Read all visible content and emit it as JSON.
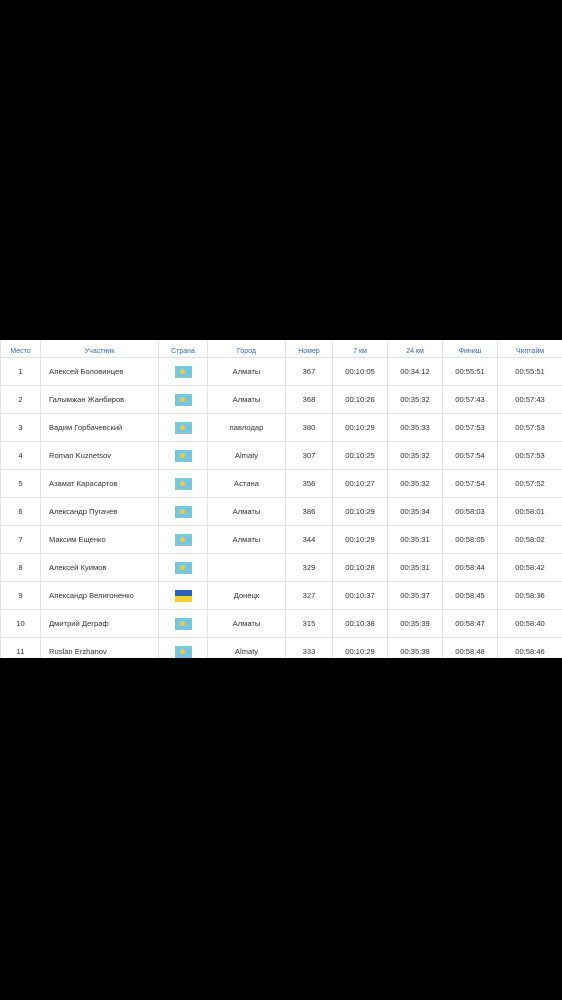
{
  "headers": [
    "Место",
    "Участник",
    "Страна",
    "Город",
    "Номер",
    "7 км",
    "24 км",
    "Финиш",
    "Чиптайм"
  ],
  "rows": [
    {
      "place": "1",
      "name": "Алексей Боловинцев",
      "flag": "kz-flag-icon",
      "city": "Алматы",
      "bib": "367",
      "split1": "00:10:05",
      "split2": "00:34:12",
      "finish": "00:55:51",
      "chip": "00:55:51"
    },
    {
      "place": "2",
      "name": "Галымжан Жанбиров",
      "flag": "kz-flag-icon",
      "city": "Алматы",
      "bib": "368",
      "split1": "00:10:26",
      "split2": "00:35:32",
      "finish": "00:57:43",
      "chip": "00:57:43"
    },
    {
      "place": "3",
      "name": "Вадим Горбачевский",
      "flag": "kz-flag-icon",
      "city": "павлодар",
      "bib": "380",
      "split1": "00:10:29",
      "split2": "00:35:33",
      "finish": "00:57:53",
      "chip": "00:57:53"
    },
    {
      "place": "4",
      "name": "Roman Kuznetsov",
      "flag": "kz-flag-icon",
      "city": "Almaty",
      "bib": "307",
      "split1": "00:10:25",
      "split2": "00:35:32",
      "finish": "00:57:54",
      "chip": "00:57:53"
    },
    {
      "place": "5",
      "name": "Азамат Карасартов",
      "flag": "kz-flag-icon",
      "city": "Астана",
      "bib": "356",
      "split1": "00:10:27",
      "split2": "00:35:32",
      "finish": "00:57:54",
      "chip": "00:57:52"
    },
    {
      "place": "6",
      "name": "Александр Пугачев",
      "flag": "kz-flag-icon",
      "city": "Алматы",
      "bib": "386",
      "split1": "00:10:29",
      "split2": "00:35:34",
      "finish": "00:58:03",
      "chip": "00:58:01"
    },
    {
      "place": "7",
      "name": "Максим Ещенко",
      "flag": "kz-flag-icon",
      "city": "Алматы",
      "bib": "344",
      "split1": "00:10:29",
      "split2": "00:35:31",
      "finish": "00:58:05",
      "chip": "00:58:02"
    },
    {
      "place": "8",
      "name": "Алексей Куимов",
      "flag": "kz-flag-icon",
      "city": "",
      "bib": "329",
      "split1": "00:10:28",
      "split2": "00:35:31",
      "finish": "00:58:44",
      "chip": "00:58:42"
    },
    {
      "place": "9",
      "name": "Александр Велигоненко",
      "flag": "ua-flag-icon",
      "city": "Донецк",
      "bib": "327",
      "split1": "00:10:37",
      "split2": "00:35:37",
      "finish": "00:58:45",
      "chip": "00:58:36"
    },
    {
      "place": "10",
      "name": "Дмитрий Деграф",
      "flag": "kz-flag-icon",
      "city": "Алматы",
      "bib": "315",
      "split1": "00:10:38",
      "split2": "00:35:39",
      "finish": "00:58:47",
      "chip": "00:58:40"
    },
    {
      "place": "11",
      "name": "Ruslan Erzhanov",
      "flag": "kz-flag-icon",
      "city": "Almaty",
      "bib": "333",
      "split1": "00:10:29",
      "split2": "00:35:39",
      "finish": "00:58:48",
      "chip": "00:58:46"
    }
  ]
}
